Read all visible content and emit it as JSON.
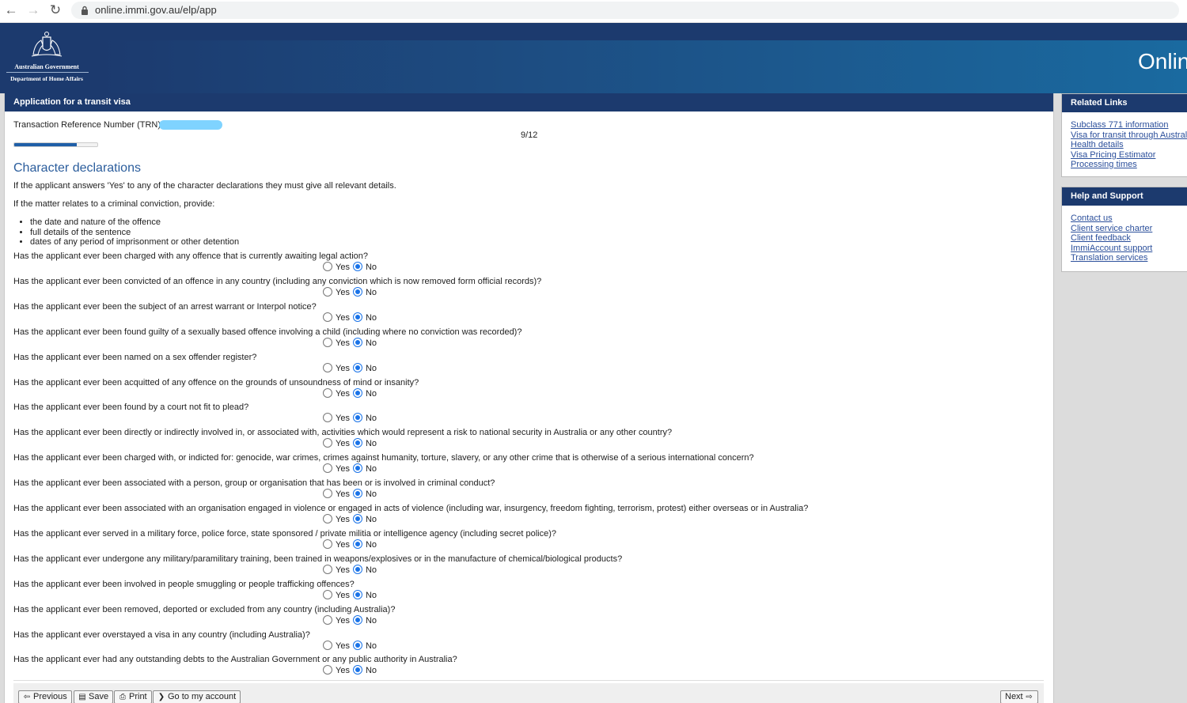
{
  "browser": {
    "url": "online.immi.gov.au/elp/app"
  },
  "header": {
    "gov_name": "Australian Government",
    "department": "Department of Home Affairs",
    "title": "Onlin"
  },
  "form": {
    "heading": "Application for a transit visa",
    "trn_label": "Transaction Reference Number (TRN):",
    "page_counter": "9/12",
    "progress_fraction": 0.75,
    "section_title": "Character declarations",
    "intro": "If the applicant answers 'Yes' to any of the character declarations they must give all relevant details.",
    "criminal_intro": "If the matter relates to a criminal conviction, provide:",
    "bullets": [
      "the date and nature of the offence",
      "full details of the sentence",
      "dates of any period of imprisonment or other detention"
    ],
    "yes_label": "Yes",
    "no_label": "No",
    "questions": [
      {
        "text": "Has the applicant ever been charged with any offence that is currently awaiting legal action?",
        "answer": "No"
      },
      {
        "text": "Has the applicant ever been convicted of an offence in any country (including any conviction which is now removed form official records)?",
        "answer": "No"
      },
      {
        "text": "Has the applicant ever been the subject of an arrest warrant or Interpol notice?",
        "answer": "No"
      },
      {
        "text": "Has the applicant ever been found guilty of a sexually based offence involving a child (including where no conviction was recorded)?",
        "answer": "No"
      },
      {
        "text": "Has the applicant ever been named on a sex offender register?",
        "answer": "No"
      },
      {
        "text": "Has the applicant ever been acquitted of any offence on the grounds of unsoundness of mind or insanity?",
        "answer": "No"
      },
      {
        "text": "Has the applicant ever been found by a court not fit to plead?",
        "answer": "No"
      },
      {
        "text": "Has the applicant ever been directly or indirectly involved in, or associated with, activities which would represent a risk to national security in Australia or any other country?",
        "answer": "No"
      },
      {
        "text": "Has the applicant ever been charged with, or indicted for: genocide, war crimes, crimes against humanity, torture, slavery, or any other crime that is otherwise of a serious international concern?",
        "answer": "No"
      },
      {
        "text": "Has the applicant ever been associated with a person, group or organisation that has been or is involved in criminal conduct?",
        "answer": "No"
      },
      {
        "text": "Has the applicant ever been associated with an organisation engaged in violence or engaged in acts of violence (including war, insurgency, freedom fighting, terrorism, protest) either overseas or in Australia?",
        "answer": "No"
      },
      {
        "text": "Has the applicant ever served in a military force, police force, state sponsored / private militia or intelligence agency (including secret police)?",
        "answer": "No"
      },
      {
        "text": "Has the applicant ever undergone any military/paramilitary training, been trained in weapons/explosives or in the manufacture of chemical/biological products?",
        "answer": "No"
      },
      {
        "text": "Has the applicant ever been involved in people smuggling or people trafficking offences?",
        "answer": "No"
      },
      {
        "text": "Has the applicant ever been removed, deported or excluded from any country (including Australia)?",
        "answer": "No"
      },
      {
        "text": "Has the applicant ever overstayed a visa in any country (including Australia)?",
        "answer": "No"
      },
      {
        "text": "Has the applicant ever had any outstanding debts to the Australian Government or any public authority in Australia?",
        "answer": "No"
      }
    ]
  },
  "footer": {
    "previous": "Previous",
    "save": "Save",
    "print": "Print",
    "account": "Go to my account",
    "next": "Next"
  },
  "sidebar": {
    "related_title": "Related Links",
    "related_links": [
      "Subclass 771 information",
      "Visa for transit through Australia",
      "Health details",
      "Visa Pricing Estimator",
      "Processing times"
    ],
    "help_title": "Help and Support",
    "help_links": [
      "Contact us",
      "Client service charter",
      "Client feedback",
      "ImmiAccount support",
      "Translation services"
    ]
  },
  "colors": {
    "banner": "#1c3a6e",
    "link": "#2b4f9b",
    "radio_checked": "#1a73e8",
    "section_title": "#2b5d9c"
  }
}
